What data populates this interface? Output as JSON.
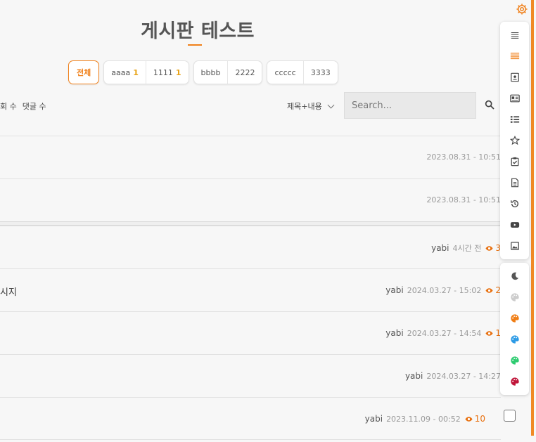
{
  "page": {
    "title": "게시판 테스트"
  },
  "categories": {
    "all_label": "전체",
    "items": [
      {
        "segments": [
          {
            "label": "aaaa",
            "count": "1"
          },
          {
            "label": "1111",
            "count": "1"
          }
        ]
      },
      {
        "segments": [
          {
            "label": "bbbb",
            "count": ""
          },
          {
            "label": "2222",
            "count": ""
          }
        ]
      },
      {
        "segments": [
          {
            "label": "ccccc",
            "count": ""
          },
          {
            "label": "3333",
            "count": ""
          }
        ]
      }
    ]
  },
  "sort": {
    "views_label": "회 수",
    "comments_label": "댓글 수"
  },
  "search": {
    "type_selected": "제목+내용",
    "placeholder": "Search..."
  },
  "notices": [
    {
      "date": "2023.08.31 - 10:51"
    },
    {
      "date": "2023.08.31 - 10:51"
    }
  ],
  "posts": [
    {
      "title": "",
      "author": "yabi",
      "date": "4시간 전",
      "views": "3"
    },
    {
      "title": "시지",
      "author": "yabi",
      "date": "2024.03.27 - 15:02",
      "views": "2"
    },
    {
      "title": "",
      "author": "yabi",
      "date": "2024.03.27 - 14:54",
      "views": "1"
    },
    {
      "title": "",
      "author": "yabi",
      "date": "2024.03.27 - 14:27",
      "views": ""
    },
    {
      "title": "",
      "author": "yabi",
      "date": "2023.11.09 - 00:52",
      "views": "10"
    }
  ],
  "sidebar": {
    "top_icons": [
      "menu-lines-icon",
      "list-orange-icon",
      "contact-card-icon",
      "id-card-icon",
      "bullet-list-icon",
      "star-icon",
      "clipboard-check-icon",
      "document-icon",
      "history-icon",
      "youtube-icon",
      "image-icon"
    ],
    "theme_icons": [
      "dark-mode-icon",
      "palette-gray-icon",
      "palette-orange-icon",
      "palette-blue-icon",
      "palette-green-icon",
      "palette-red-icon"
    ]
  },
  "colors": {
    "accent": "#f0801a",
    "palette_gray": "#cccccc",
    "palette_orange": "#f07d14",
    "palette_blue": "#2d9be6",
    "palette_green": "#2ecc71",
    "palette_red": "#c0163a"
  }
}
